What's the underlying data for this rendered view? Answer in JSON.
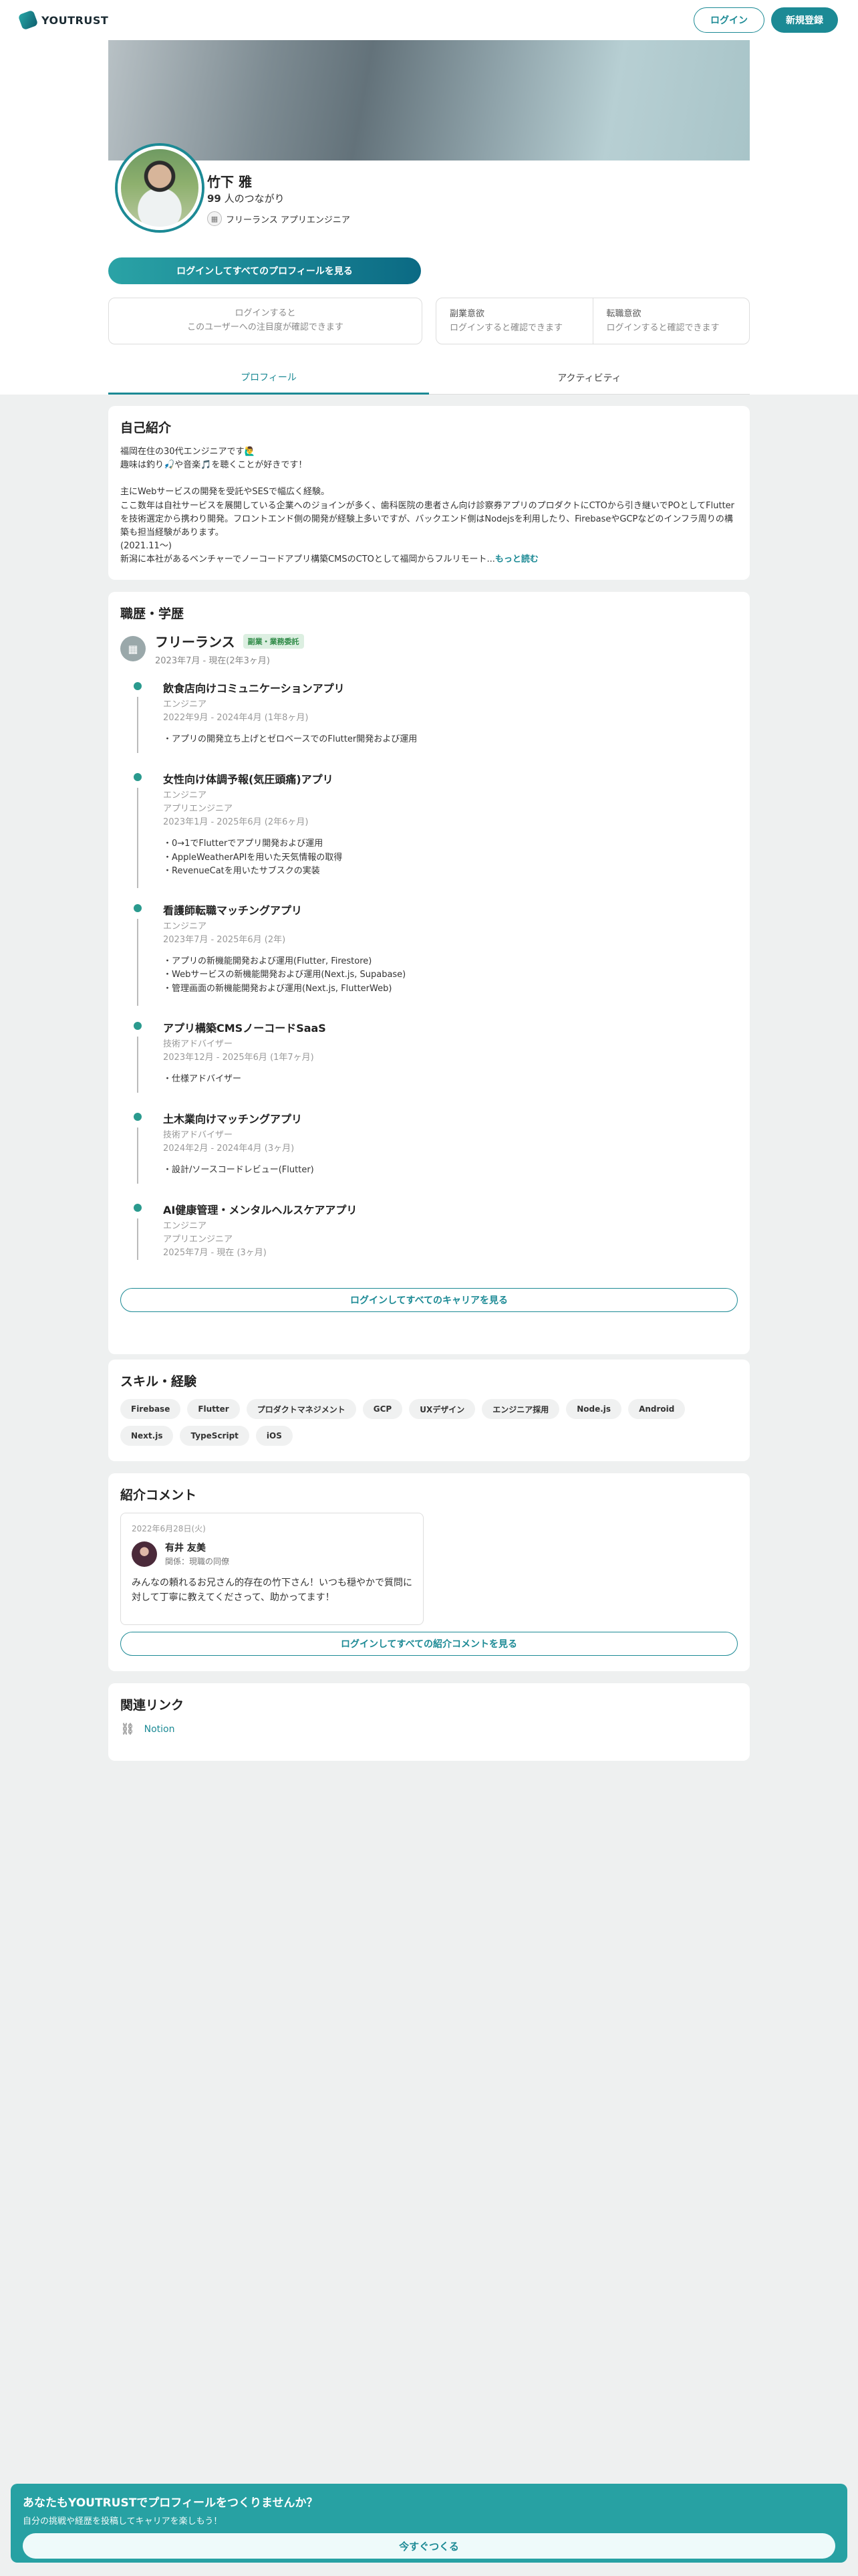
{
  "header": {
    "logo_text": "YOUTRUST",
    "login_label": "ログイン",
    "signup_label": "新規登録"
  },
  "profile": {
    "name": "竹下 雅",
    "connections_count": "99",
    "connections_label": " 人のつながり",
    "occupation": "フリーランス アプリエンジニア",
    "login_view_all": "ログインしてすべてのプロフィールを見る",
    "attention_line1": "ログインすると",
    "attention_line2": "このユーザーへの注目度が確認できます",
    "side_job_title": "副業意欲",
    "side_job_value": "ログインすると確認できます",
    "job_change_title": "転職意欲",
    "job_change_value": "ログインすると確認できます"
  },
  "tabs": [
    {
      "label": "プロフィール",
      "active": true
    },
    {
      "label": "アクティビティ",
      "active": false
    }
  ],
  "intro": {
    "heading": "自己紹介",
    "text": "福岡在住の30代エンジニアです🙋‍♂️\n趣味は釣り🎣や音楽🎵を聴くことが好きです！\n\n主にWebサービスの開発を受託やSESで幅広く経験。\nここ数年は自社サービスを展開している企業へのジョインが多く、歯科医院の患者さん向け診察券アプリのプロダクトにCTOから引き継いでPOとしてFlutterを技術選定から携わり開発。フロントエンド側の開発が経験上多いですが、バックエンド側はNodejsを利用したり、FirebaseやGCPなどのインフラ周りの構築も担当経験があります。\n(2021.11〜)\n新潟に本社があるベンチャーでノーコードアプリ構築CMSのCTOとして福岡からフルリモート...",
    "more_label": "もっと読む"
  },
  "career": {
    "heading": "職歴・学歴",
    "company": "フリーランス",
    "badge": "副業・業務委託",
    "period": "2023年7月 - 現在(2年3ヶ月)",
    "projects": [
      {
        "title": "飲食店向けコミュニケーションアプリ",
        "sub": [
          "エンジニア",
          "2022年9月 - 2024年4月 (1年8ヶ月)"
        ],
        "desc": [
          "・アプリの開発立ち上げとゼロベースでのFlutter開発および運用"
        ]
      },
      {
        "title": "女性向け体調予報(気圧頭痛)アプリ",
        "sub": [
          "エンジニア",
          "アプリエンジニア",
          "2023年1月 - 2025年6月 (2年6ヶ月)"
        ],
        "desc": [
          "・0→1でFlutterでアプリ開発および運用",
          "・AppleWeatherAPIを用いた天気情報の取得",
          "・RevenueCatを用いたサブスクの実装"
        ]
      },
      {
        "title": "看護師転職マッチングアプリ",
        "sub": [
          "エンジニア",
          "2023年7月 - 2025年6月 (2年)"
        ],
        "desc": [
          "・アプリの新機能開発および運用(Flutter, Firestore)",
          "・Webサービスの新機能開発および運用(Next.js, Supabase)",
          "・管理画面の新機能開発および運用(Next.js, FlutterWeb)"
        ]
      },
      {
        "title": "アプリ構築CMSノーコードSaaS",
        "sub": [
          "技術アドバイザー",
          "2023年12月 - 2025年6月 (1年7ヶ月)"
        ],
        "desc": [
          "・仕様アドバイザー"
        ]
      },
      {
        "title": "土木業向けマッチングアプリ",
        "sub": [
          "技術アドバイザー",
          "2024年2月 - 2024年4月 (3ヶ月)"
        ],
        "desc": [
          "・設計/ソースコードレビュー(Flutter)"
        ]
      },
      {
        "title": "AI健康管理・メンタルヘルスケアアプリ",
        "sub": [
          "エンジニア",
          "アプリエンジニア",
          "2025年7月 - 現在 (3ヶ月)"
        ],
        "desc": []
      }
    ],
    "view_all_label": "ログインしてすべてのキャリアを見る"
  },
  "skills": {
    "heading": "スキル・経験",
    "items": [
      "Firebase",
      "Flutter",
      "プロダクトマネジメント",
      "GCP",
      "UXデザイン",
      "エンジニア採用",
      "Node.js",
      "Android",
      "Next.js",
      "TypeScript",
      "iOS"
    ]
  },
  "references": {
    "heading": "紹介コメント",
    "date": "2022年6月28日(火)",
    "author": "有井 友美",
    "relation": "関係：現職の同僚",
    "text": "みんなの頼れるお兄さん的存在の竹下さん！いつも穏やかで質問に対して丁寧に教えてくださって、助かってます！",
    "view_all_label": "ログインしてすべての紹介コメントを見る"
  },
  "links": {
    "heading": "関連リンク",
    "items": [
      {
        "label": "Notion",
        "icon": "link-icon"
      }
    ]
  },
  "banner": {
    "title": "あなたもYOUTRUSTでプロフィールをつくりませんか？",
    "subtitle": "自分の挑戦や経歴を投稿してキャリアを楽しもう！",
    "cta": "今すぐつくる"
  },
  "colors": {
    "accent": "#1c8a95",
    "timeline_dot": "#2a9a8e",
    "banner": "#27a1a3",
    "page_bg": "#eef0f0"
  }
}
